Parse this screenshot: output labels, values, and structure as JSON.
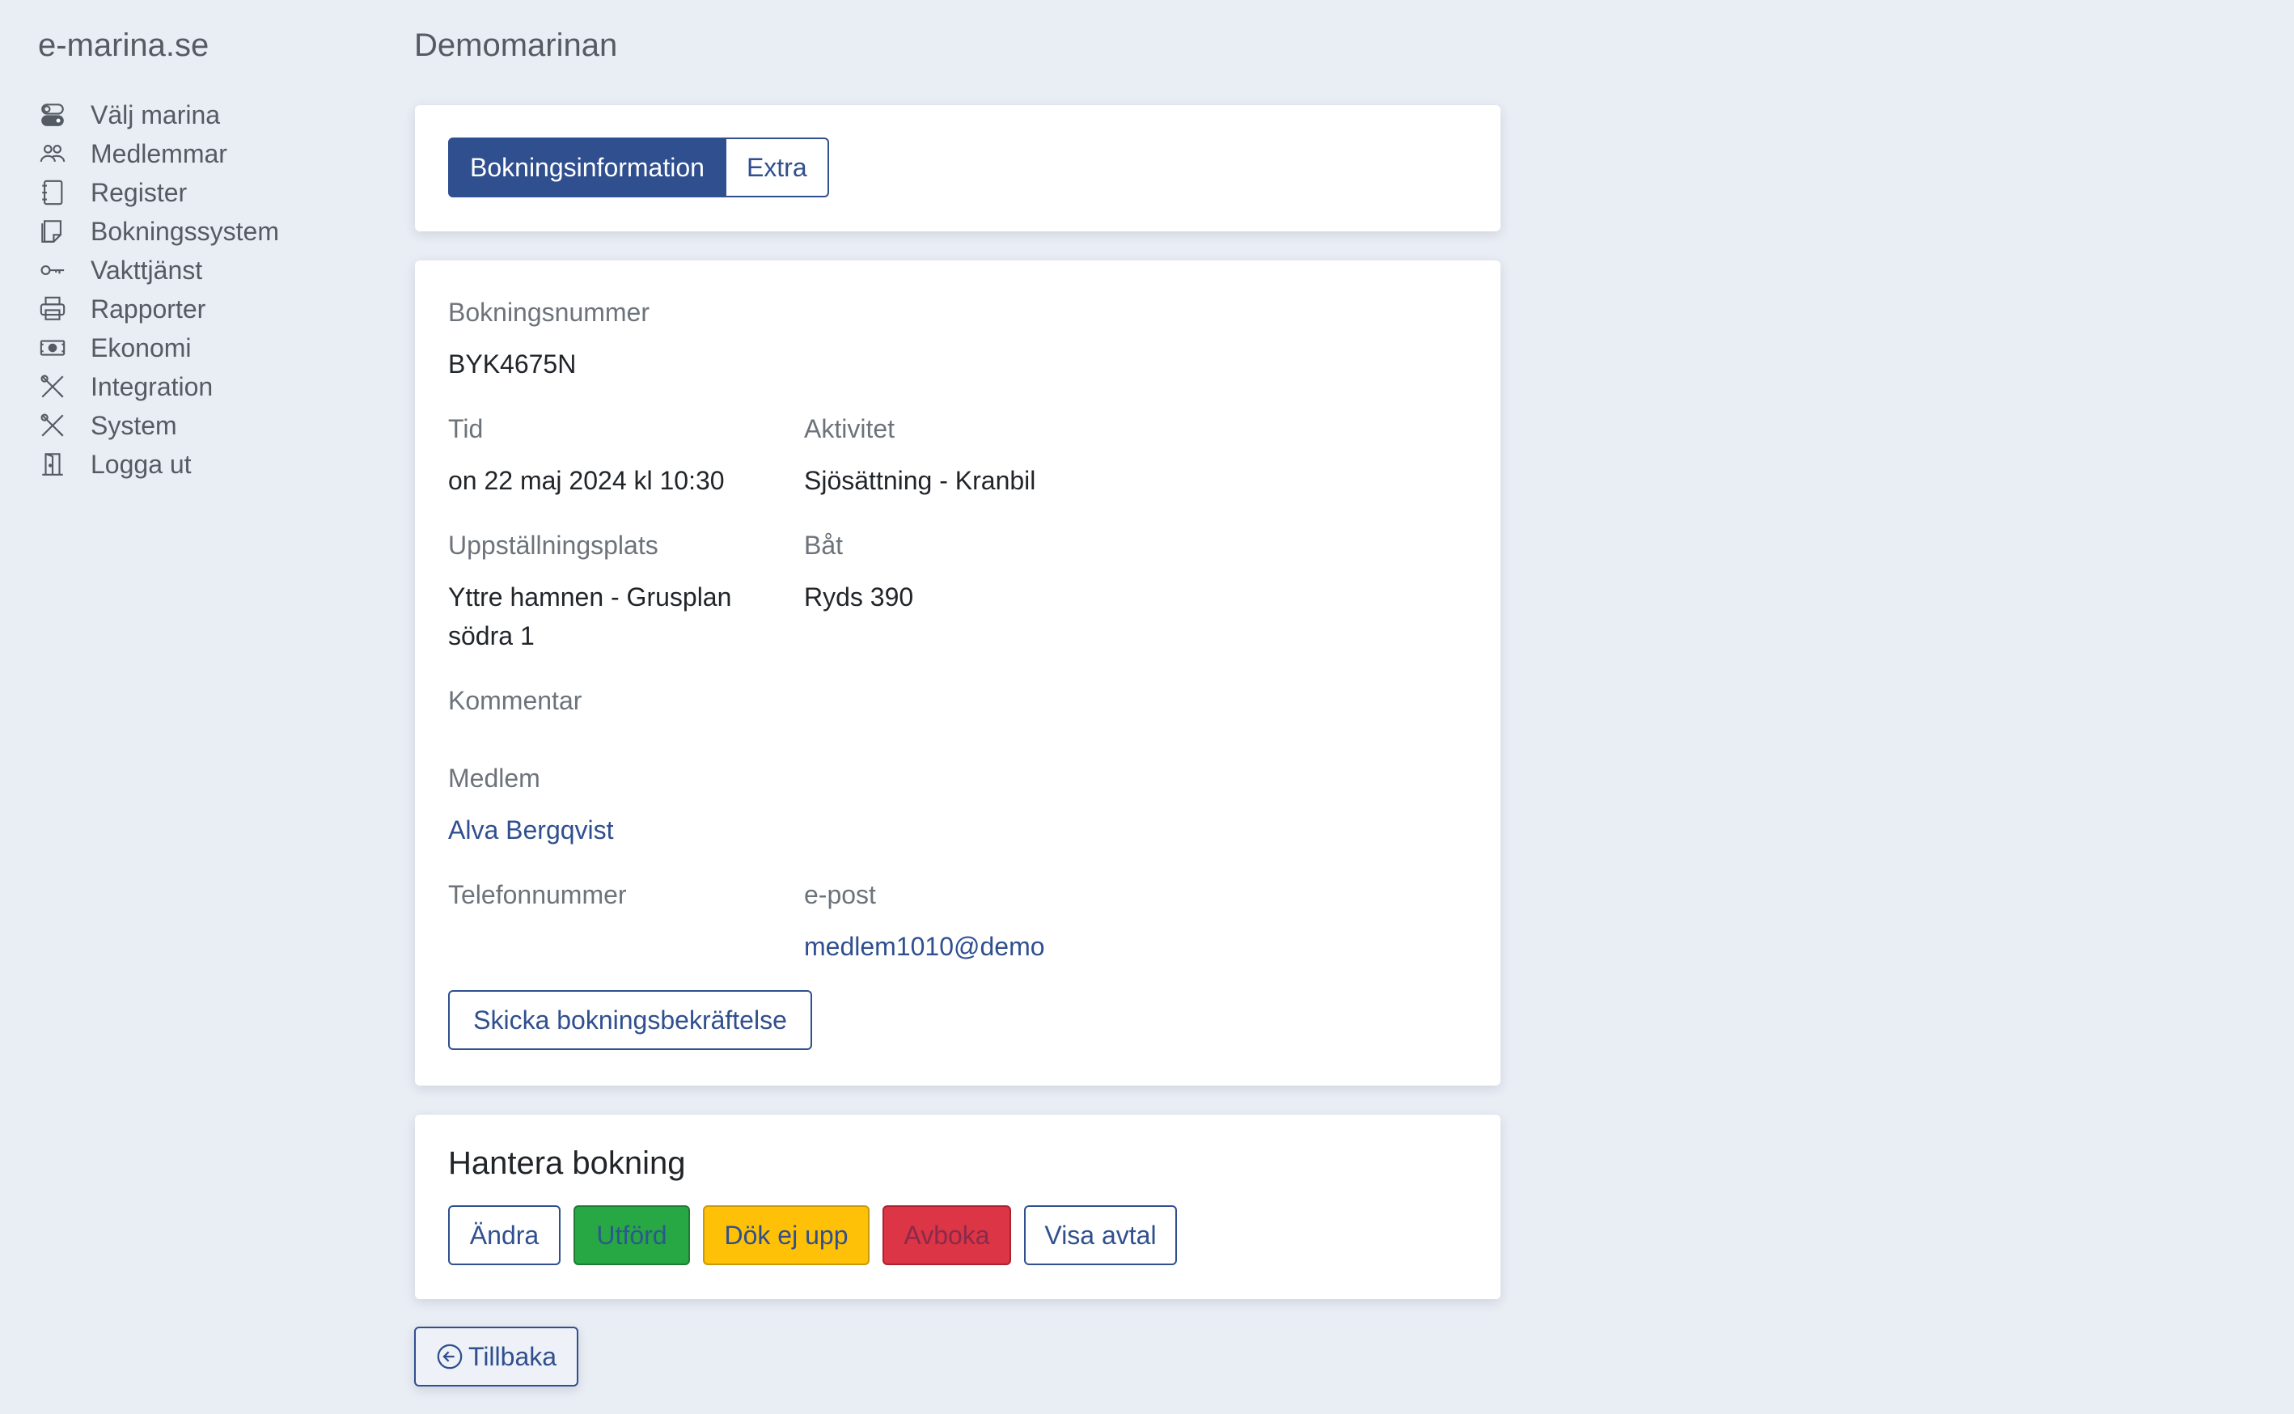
{
  "sidebar": {
    "brand": "e-marina.se",
    "items": [
      {
        "label": "Välj marina",
        "icon": "toggles-icon"
      },
      {
        "label": "Medlemmar",
        "icon": "people-icon"
      },
      {
        "label": "Register",
        "icon": "journal-icon"
      },
      {
        "label": "Bokningssystem",
        "icon": "sticky-note-icon"
      },
      {
        "label": "Vakttjänst",
        "icon": "key-icon"
      },
      {
        "label": "Rapporter",
        "icon": "printer-icon"
      },
      {
        "label": "Ekonomi",
        "icon": "cash-icon"
      },
      {
        "label": "Integration",
        "icon": "tools-icon"
      },
      {
        "label": "System",
        "icon": "tools-icon"
      },
      {
        "label": "Logga ut",
        "icon": "door-icon"
      }
    ]
  },
  "header": {
    "title": "Demomarinan"
  },
  "tabs": {
    "info": "Bokningsinformation",
    "extra": "Extra"
  },
  "booking": {
    "number_label": "Bokningsnummer",
    "number": "BYK4675N",
    "time_label": "Tid",
    "time": "on 22 maj 2024 kl 10:30",
    "activity_label": "Aktivitet",
    "activity": "Sjösättning - Kranbil",
    "location_label": "Uppställningsplats",
    "location_line1": "Yttre hamnen - Grusplan",
    "location_line2": "södra 1",
    "boat_label": "Båt",
    "boat": "Ryds 390",
    "comment_label": "Kommentar",
    "member_label": "Medlem",
    "member": "Alva Bergqvist",
    "phone_label": "Telefonnummer",
    "email_label": "e-post",
    "email": "medlem1010@demo",
    "send_confirmation": "Skicka bokningsbekräftelse"
  },
  "manage": {
    "title": "Hantera bokning",
    "edit": "Ändra",
    "done": "Utförd",
    "no_show": "Dök ej upp",
    "cancel": "Avboka",
    "show_agreement": "Visa avtal"
  },
  "back_label": "Tillbaka",
  "colors": {
    "primary": "#2f4f8f",
    "success": "#28a745",
    "warning": "#ffc107",
    "danger": "#dc3545",
    "background": "#e9edf4"
  }
}
